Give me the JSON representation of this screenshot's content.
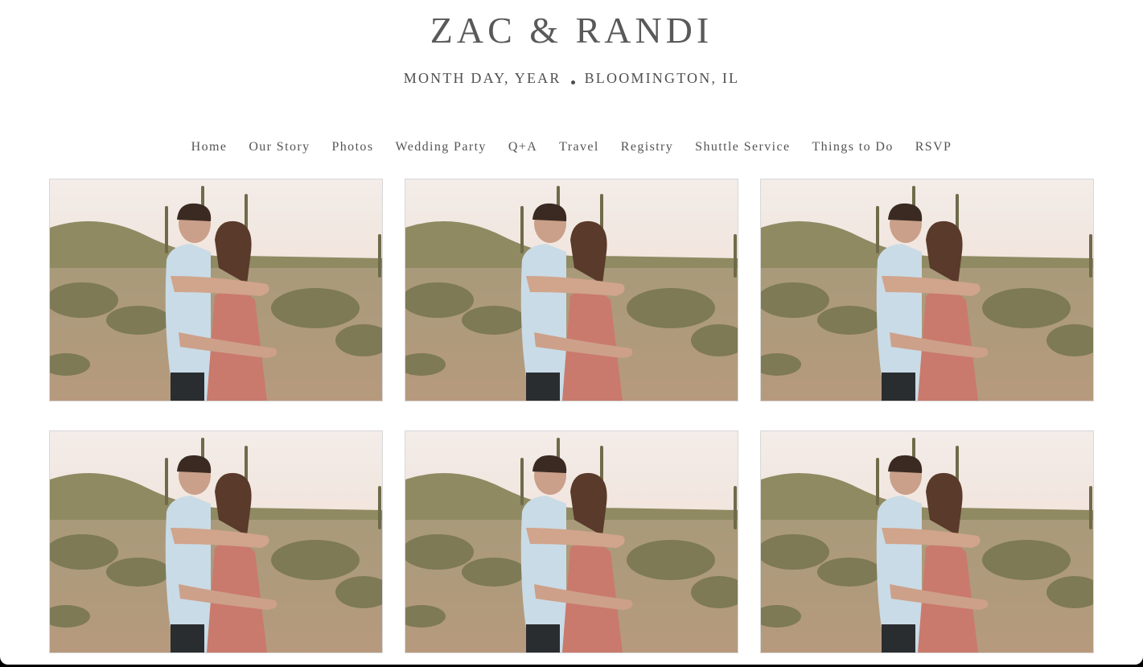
{
  "header": {
    "title": "ZAC & RANDI",
    "date": "MONTH DAY, YEAR",
    "location": "BLOOMINGTON, IL"
  },
  "nav": {
    "items": [
      {
        "label": "Home"
      },
      {
        "label": "Our Story"
      },
      {
        "label": "Photos"
      },
      {
        "label": "Wedding Party"
      },
      {
        "label": "Q+A"
      },
      {
        "label": "Travel"
      },
      {
        "label": "Registry"
      },
      {
        "label": "Shuttle Service"
      },
      {
        "label": "Things to Do"
      },
      {
        "label": "RSVP"
      }
    ]
  },
  "gallery": {
    "photos": [
      {
        "subject": "couple-embrace-desert"
      },
      {
        "subject": "couple-embrace-desert"
      },
      {
        "subject": "couple-embrace-desert"
      },
      {
        "subject": "couple-embrace-desert"
      },
      {
        "subject": "couple-embrace-desert"
      },
      {
        "subject": "couple-embrace-desert"
      }
    ]
  },
  "colors": {
    "text": "#555555",
    "sky": "#f1e4dc",
    "desert_ground": "#b79a7e",
    "shirt": "#c9dbe6",
    "dress": "#c97a6c"
  }
}
